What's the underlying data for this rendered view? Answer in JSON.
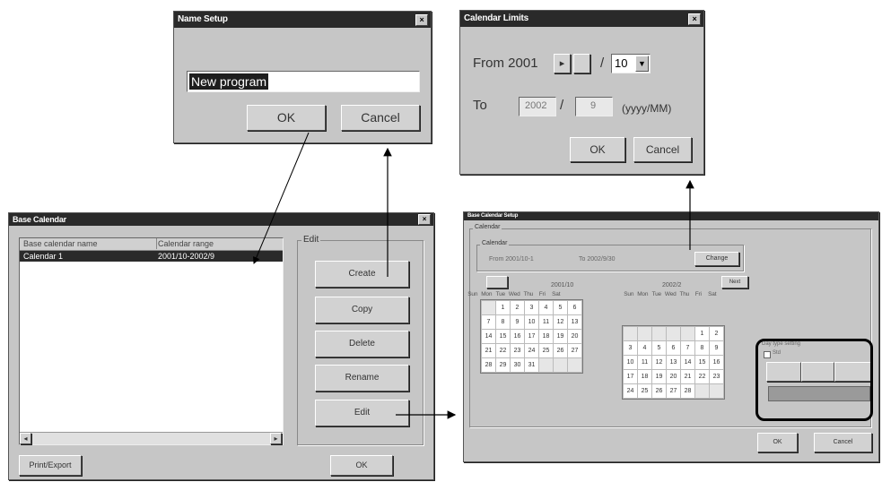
{
  "name_setup": {
    "title": "Name Setup",
    "input_value": "New program",
    "ok_label": "OK",
    "cancel_label": "Cancel"
  },
  "calendar_limits": {
    "title": "Calendar Limits",
    "from_label": "From 2001",
    "from_month": "10",
    "separator": "/",
    "to_label": "To",
    "to_year": "2002",
    "to_month": "9",
    "format_hint": "(yyyy/MM)",
    "ok_label": "OK",
    "cancel_label": "Cancel"
  },
  "base_calendar": {
    "title": "Base Calendar",
    "col_name": "Base calendar name",
    "col_range": "Calendar range",
    "row_name": "Calendar 1",
    "row_range": "2001/10-2002/9",
    "edit_group": "Edit",
    "create_label": "Create",
    "copy_label": "Copy",
    "delete_label": "Delete",
    "rename_label": "Rename",
    "edit_label": "Edit",
    "print_label": "Print/Export",
    "ok_label": "OK",
    "scroll_left": "◂",
    "scroll_right": "▸"
  },
  "base_calendar_setup": {
    "title": "Base Calendar Setup",
    "group_calendar": "Calendar",
    "sub_calendar": "Calendar",
    "from_text": "From 2001/10-1",
    "to_text": "To 2002/9/30",
    "change_label": "Change",
    "month_left": "2001/10",
    "month_right": "2002/2",
    "nav_left_label": "",
    "nav_right_label": "Next",
    "day_headers": [
      "Sun",
      "Mon",
      "Tue",
      "Wed",
      "Thu",
      "Fri",
      "Sat"
    ],
    "cal_left": [
      [
        "",
        "1",
        "2",
        "3",
        "4",
        "5",
        "6"
      ],
      [
        "7",
        "8",
        "9",
        "10",
        "11",
        "12",
        "13"
      ],
      [
        "14",
        "15",
        "16",
        "17",
        "18",
        "19",
        "20"
      ],
      [
        "21",
        "22",
        "23",
        "24",
        "25",
        "26",
        "27"
      ],
      [
        "28",
        "29",
        "30",
        "31",
        "",
        "",
        ""
      ]
    ],
    "cal_right": [
      [
        "",
        "",
        "",
        "",
        "",
        "1",
        "2"
      ],
      [
        "3",
        "4",
        "5",
        "6",
        "7",
        "8",
        "9"
      ],
      [
        "10",
        "11",
        "12",
        "13",
        "14",
        "15",
        "16"
      ],
      [
        "17",
        "18",
        "19",
        "20",
        "21",
        "22",
        "23"
      ],
      [
        "24",
        "25",
        "26",
        "27",
        "28",
        "",
        ""
      ]
    ],
    "day_setting_label": "Day type setting",
    "check_label": "Std",
    "ok_label": "OK",
    "cancel_label": "Cancel"
  }
}
